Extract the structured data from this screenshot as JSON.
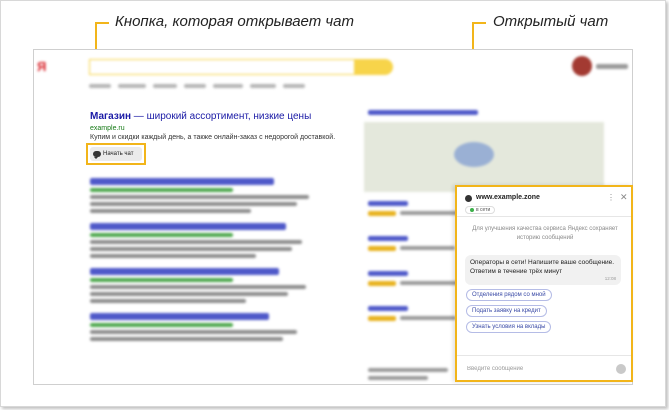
{
  "annotations": {
    "chat_button_label": "Кнопка, которая открывает чат",
    "open_chat_label": "Открытый чат"
  },
  "ad": {
    "title_brand": "Магазин",
    "title_rest": " — широкий ассортимент, низкие цены",
    "url": "example.ru",
    "description": "Купим и скидки каждый день, а также онлайн-заказ с недорогой доставкой.",
    "chat_button": "Начать чат",
    "chat_icon": "chat-bubble-icon"
  },
  "chat": {
    "site": "www.example.zone",
    "status": "в сети",
    "info": "Для улучшения качества сервиса Яндекс сохраняет историю сообщений",
    "message": "Операторы в сети! Напишите ваше сообщение. Ответим в течение трёх минут",
    "time": "12:08",
    "options": [
      "Отделения рядом со мной",
      "Подать заявку на кредит",
      "Узнать условия на вклады"
    ],
    "input_placeholder": "Введите сообщение"
  },
  "colors": {
    "highlight": "#f2b51a",
    "link": "#1a1aa6",
    "url_green": "#167a16"
  }
}
